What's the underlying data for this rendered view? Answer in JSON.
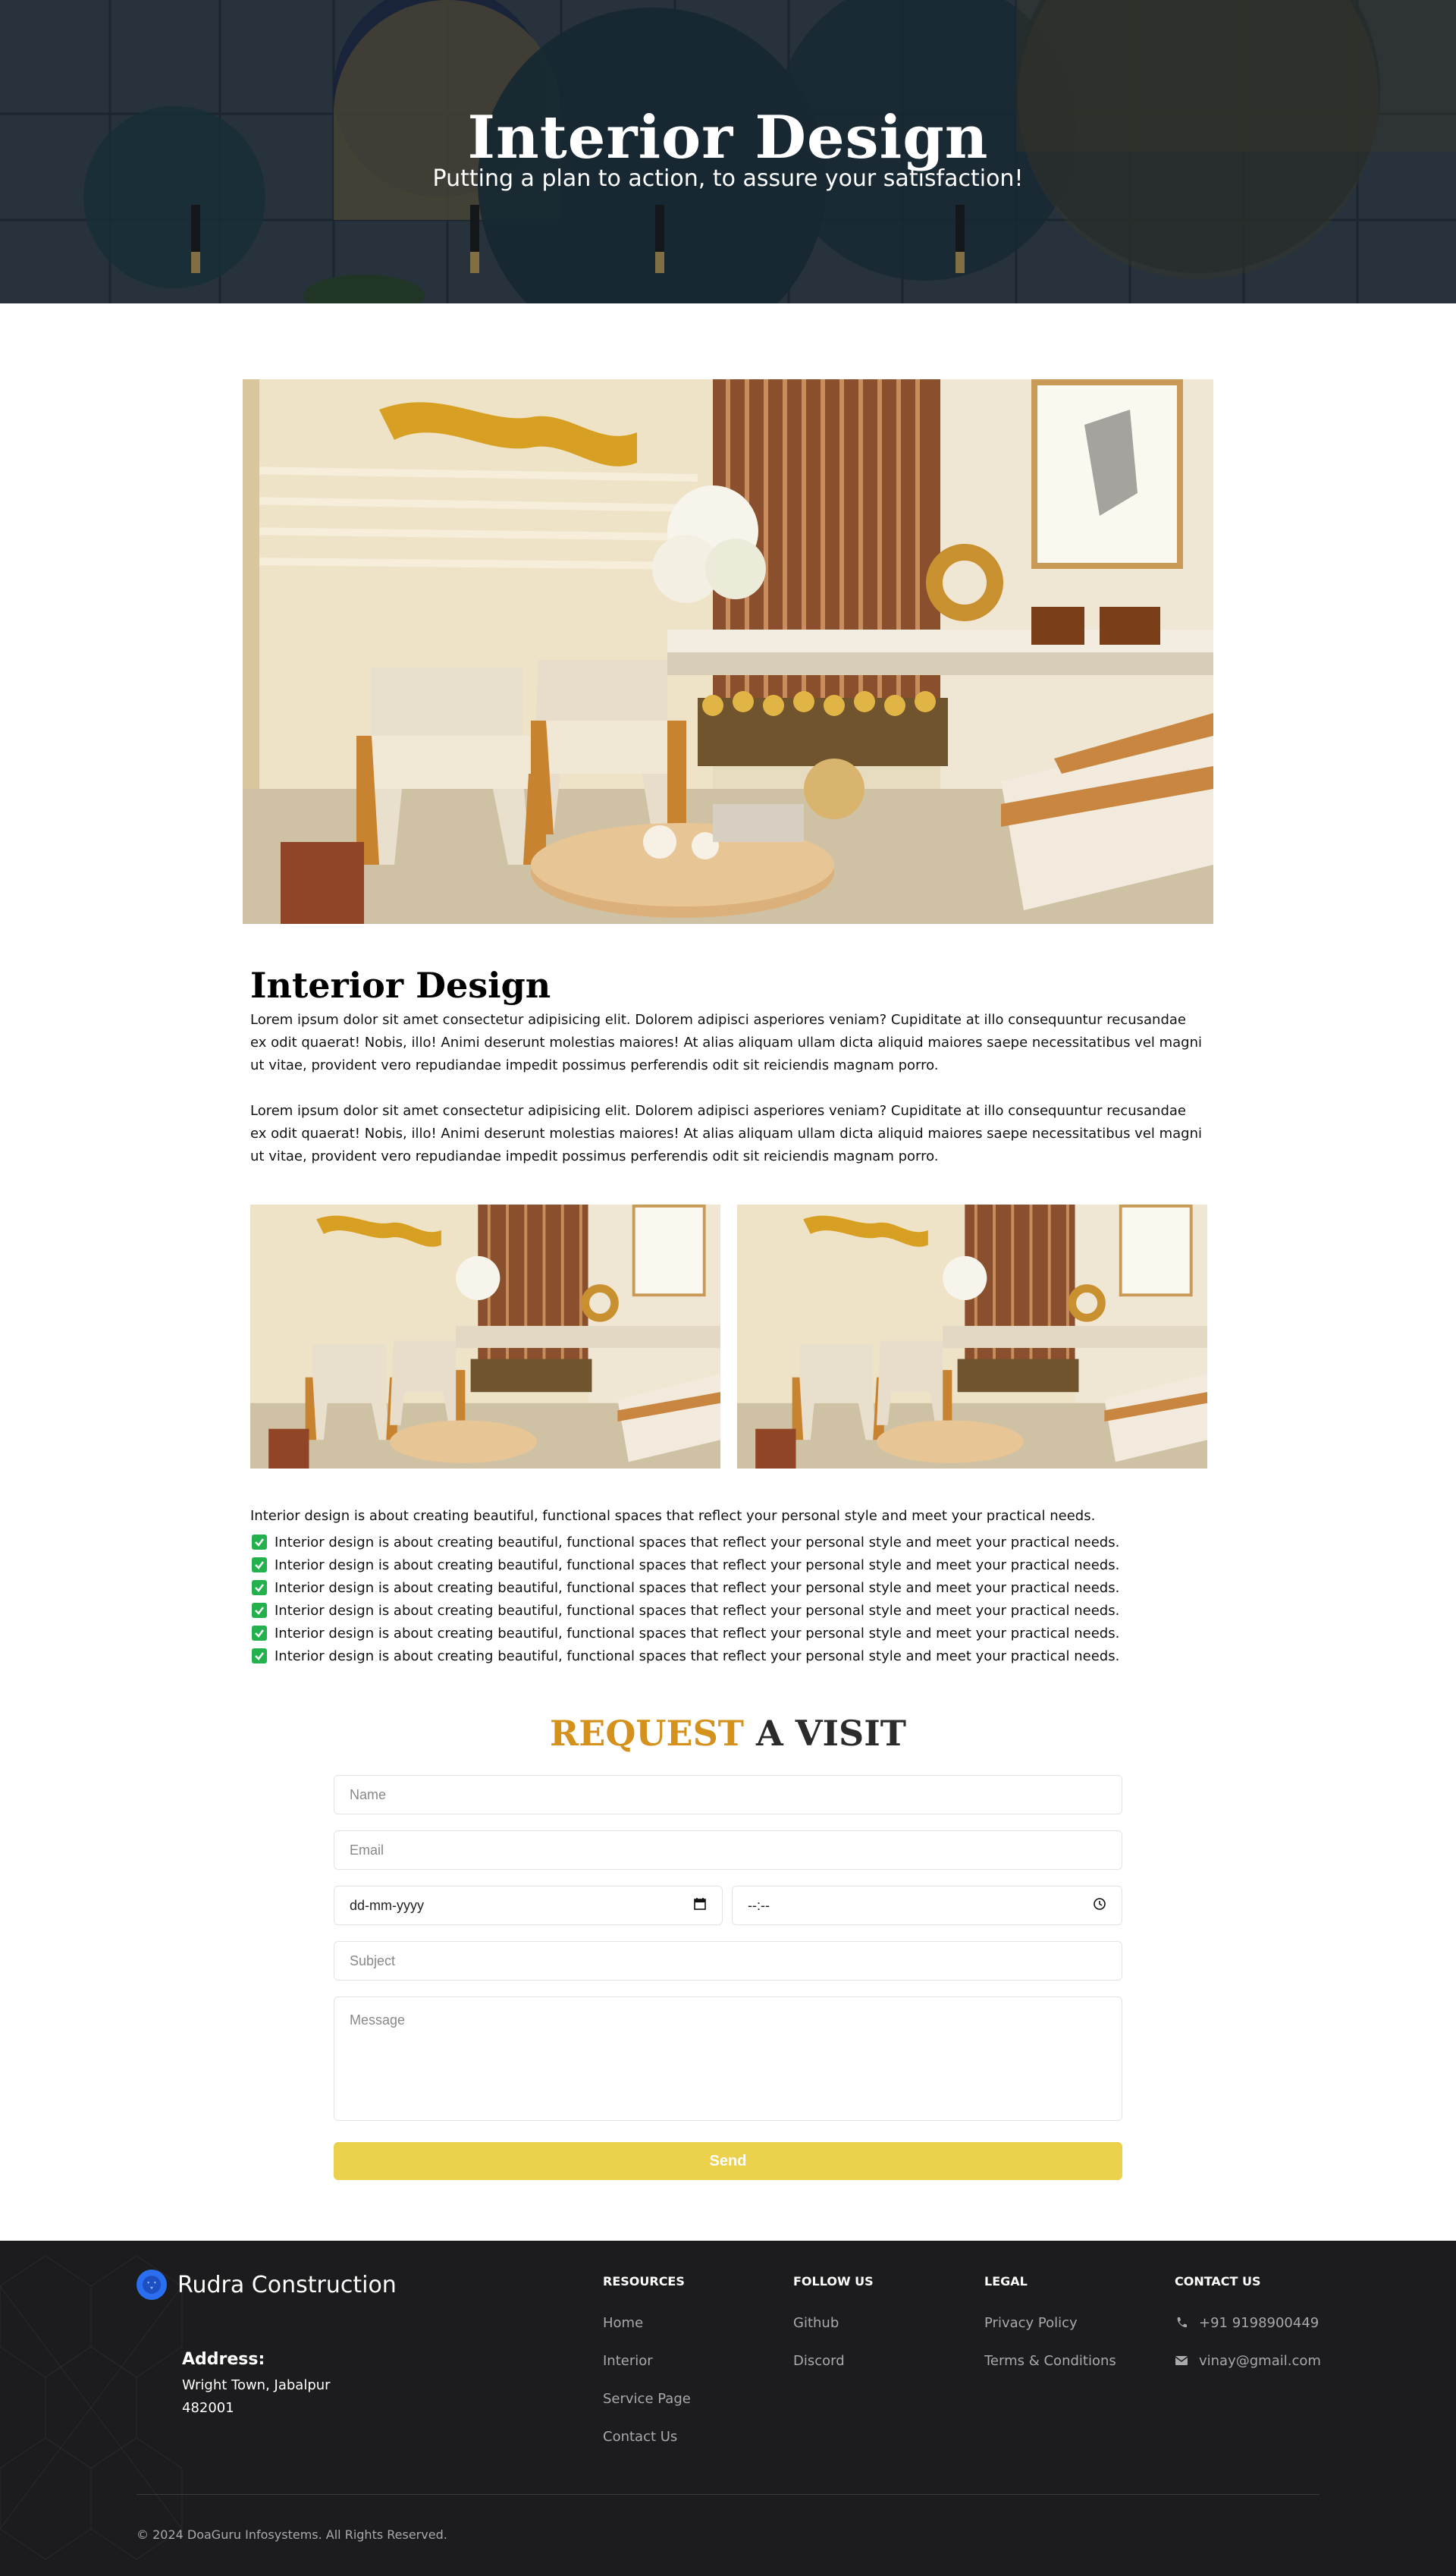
{
  "hero": {
    "title": "Interior Design",
    "subtitle": "Putting a plan to action, to assure your satisfaction!"
  },
  "article": {
    "title": "Interior Design",
    "paragraphs": [
      "Lorem ipsum dolor sit amet consectetur adipisicing elit. Dolorem adipisci asperiores veniam? Cupiditate at illo consequuntur recusandae ex odit quaerat! Nobis, illo! Animi deserunt molestias maiores! At alias aliquam ullam dicta aliquid maiores saepe necessitatibus vel magni ut vitae, provident vero repudiandae impedit possimus perferendis odit sit reiciendis magnam porro.",
      "Lorem ipsum dolor sit amet consectetur adipisicing elit. Dolorem adipisci asperiores veniam? Cupiditate at illo consequuntur recusandae ex odit quaerat! Nobis, illo! Animi deserunt molestias maiores! At alias aliquam ullam dicta aliquid maiores saepe necessitatibus vel magni ut vitae, provident vero repudiandae impedit possimus perferendis odit sit reiciendis magnam porro."
    ],
    "intro": "Interior design is about creating beautiful, functional spaces that reflect your personal style and meet your practical needs.",
    "checklist": [
      "Interior design is about creating beautiful, functional spaces that reflect your personal style and meet your practical needs.",
      "Interior design is about creating beautiful, functional spaces that reflect your personal style and meet your practical needs.",
      "Interior design is about creating beautiful, functional spaces that reflect your personal style and meet your practical needs.",
      "Interior design is about creating beautiful, functional spaces that reflect your personal style and meet your practical needs.",
      "Interior design is about creating beautiful, functional spaces that reflect your personal style and meet your practical needs.",
      "Interior design is about creating beautiful, functional spaces that reflect your personal style and meet your practical needs."
    ]
  },
  "form": {
    "title_accent": "REQUEST",
    "title_rest": " A VISIT",
    "name_placeholder": "Name",
    "email_placeholder": "Email",
    "date_value": "dd-mm-yyyy",
    "time_value": "--:--",
    "subject_placeholder": "Subject",
    "message_placeholder": "Message",
    "send_label": "Send"
  },
  "footer": {
    "brand": "Rudra Construction",
    "address_label": "Address:",
    "address_line1": "Wright Town, Jabalpur",
    "address_line2": "482001",
    "columns": {
      "resources": {
        "title": "RESOURCES",
        "links": [
          "Home",
          "Interior",
          "Service Page",
          "Contact Us"
        ]
      },
      "follow": {
        "title": "FOLLOW US",
        "links": [
          "Github",
          "Discord"
        ]
      },
      "legal": {
        "title": "LEGAL",
        "links": [
          "Privacy Policy",
          "Terms & Conditions"
        ]
      },
      "contact": {
        "title": "CONTACT US",
        "phone": "+91 9198900449",
        "email": "vinay@gmail.com"
      }
    },
    "copyright": "© 2024 DoaGuru Infosystems. All Rights Reserved."
  },
  "colors": {
    "accent": "#d4911c",
    "send_button": "#ecd14c",
    "check": "#22b14c",
    "footer_bg": "#1c1c1e",
    "logo": "#2a6ff0"
  }
}
